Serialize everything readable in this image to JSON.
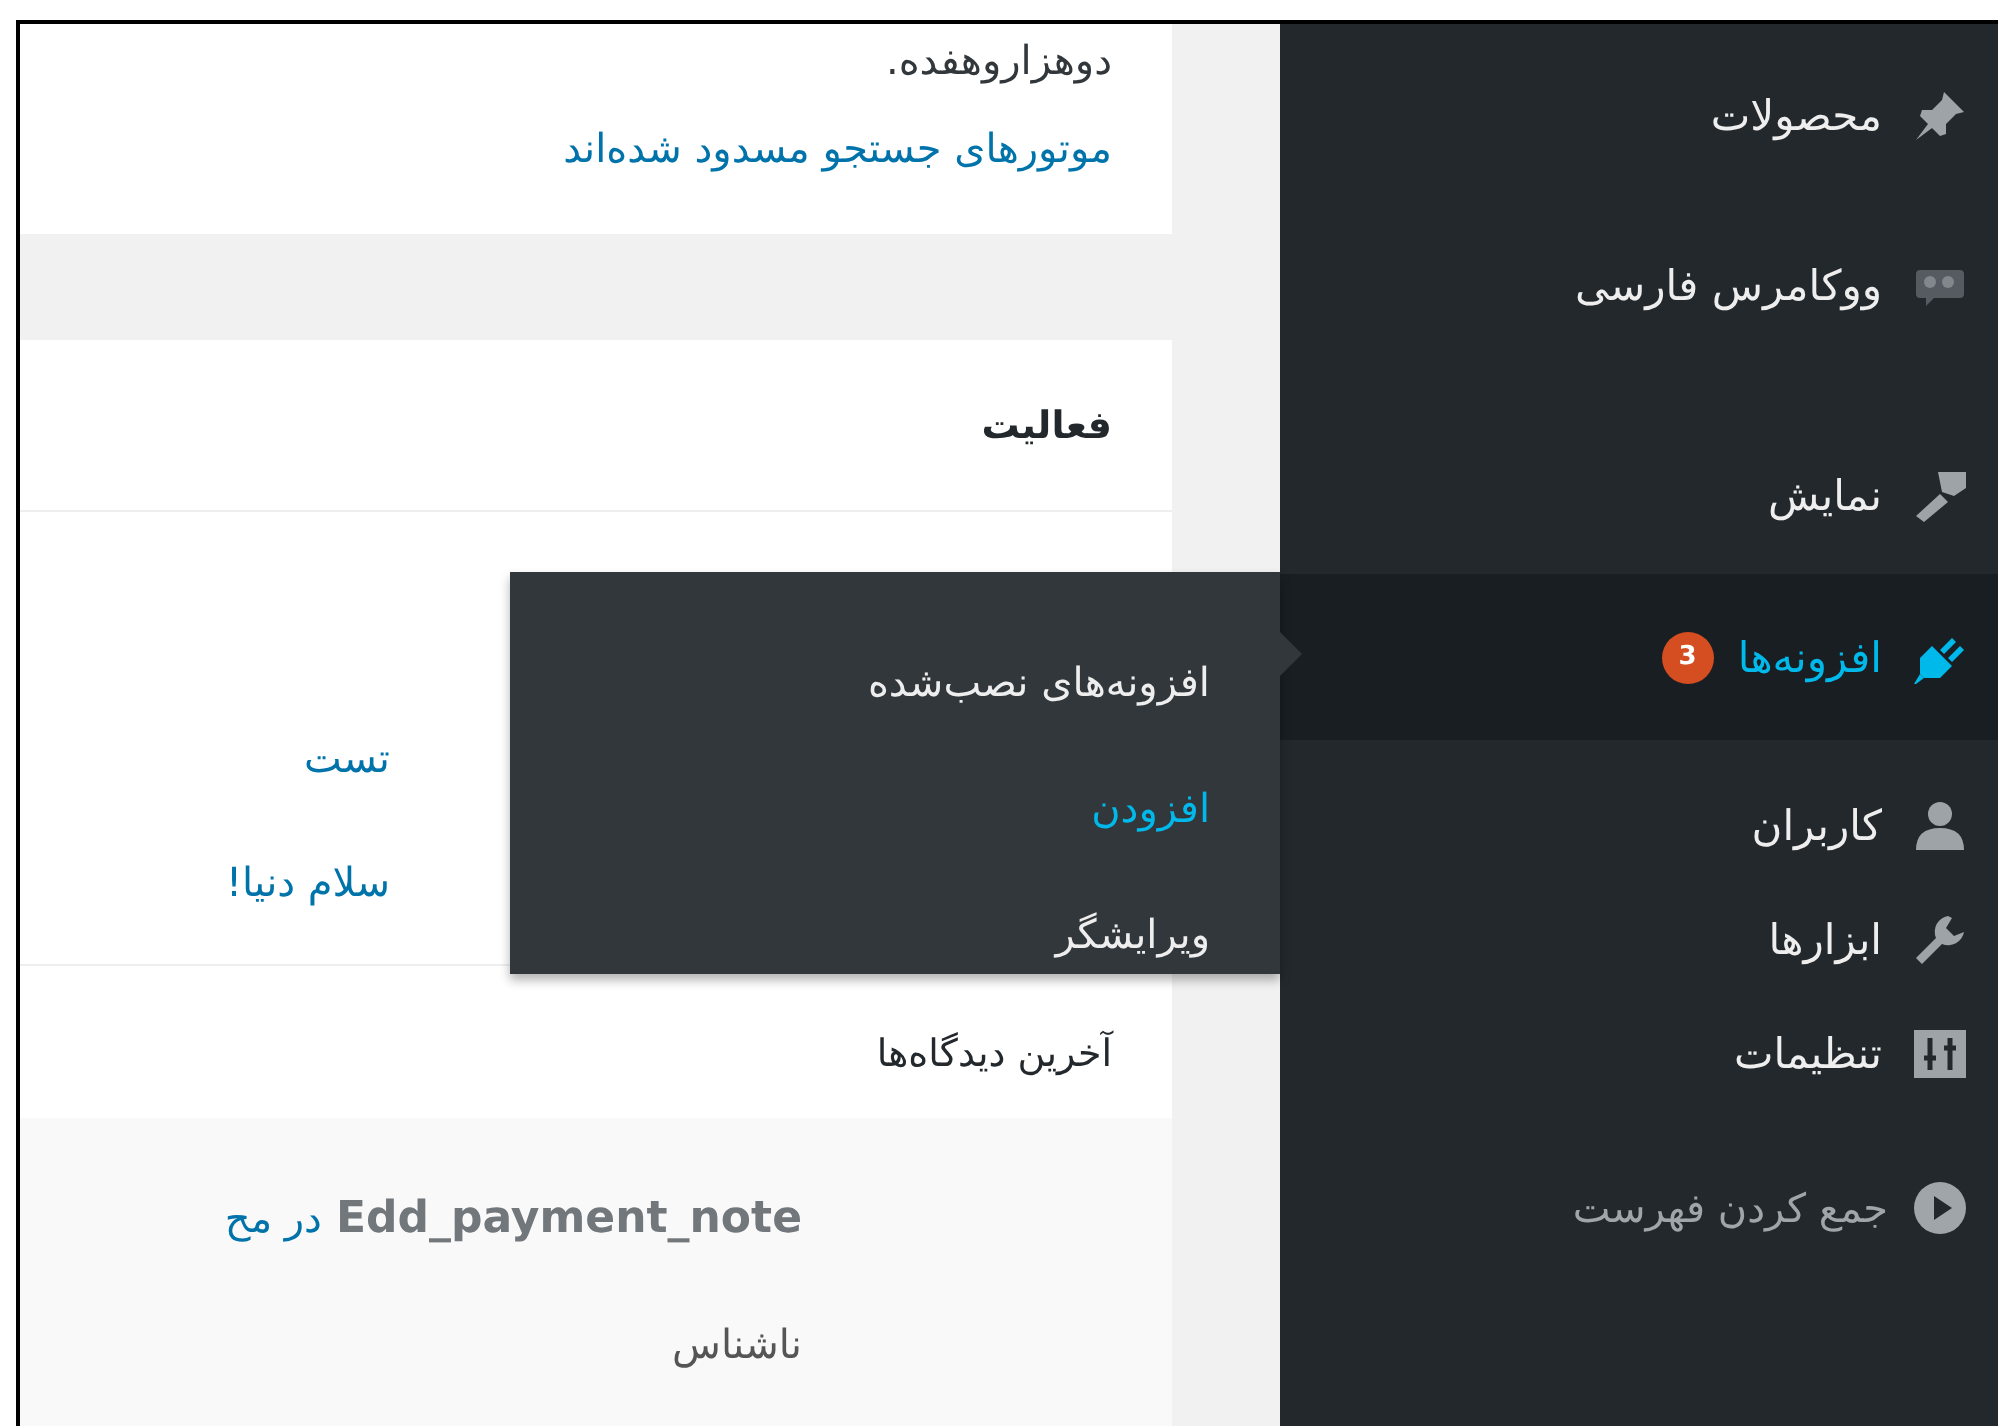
{
  "content": {
    "site_notice": {
      "text": "دوهزاروهفده.",
      "link": "موتورهای جستجو مسدود شده‌اند"
    },
    "activity": {
      "title": "فعالیت",
      "links": [
        "تست",
        "سلام دنیا!"
      ],
      "recent_comments_title": "آخرین دیدگاه‌ها",
      "comment": {
        "post": "Edd_payment_note",
        "link": "در مح",
        "author": "ناشناس"
      }
    }
  },
  "sidebar": {
    "items": [
      {
        "label": "محصولات",
        "selected": false
      },
      {
        "label": "ووکامرس فارسی",
        "selected": false
      },
      {
        "label": "نمایش",
        "selected": false
      },
      {
        "label": "افزونه‌ها",
        "selected": true,
        "badge": "3"
      },
      {
        "label": "کاربران",
        "selected": false
      },
      {
        "label": "ابزارها",
        "selected": false
      },
      {
        "label": "تنظیمات",
        "selected": false
      }
    ],
    "collapse": "جمع کردن فهرست"
  },
  "flyout": {
    "items": [
      {
        "label": "افزونه‌های نصب‌شده",
        "selected": false
      },
      {
        "label": "افزودن",
        "selected": true
      },
      {
        "label": "ویرایشگر",
        "selected": false
      }
    ]
  }
}
